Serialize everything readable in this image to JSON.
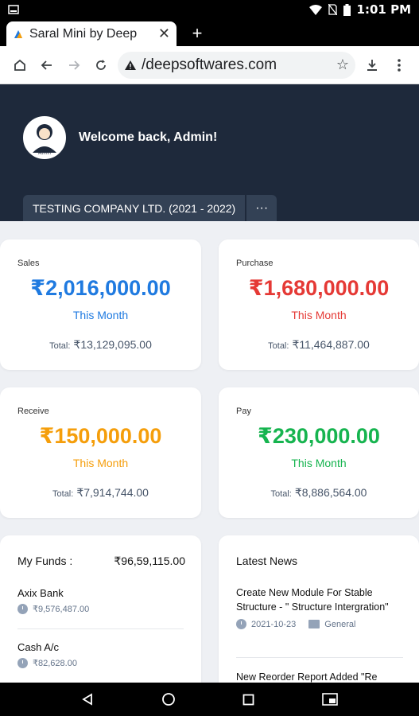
{
  "status_bar": {
    "time": "1:01 PM"
  },
  "browser": {
    "tab_title": "Saral Mini by Deep",
    "url": "deepsoftwares.com",
    "url_prefix": "/"
  },
  "header": {
    "welcome": "Welcome back, Admin!",
    "avatar_label": "Admin",
    "company": "TESTING COMPANY LTD. (2021 - 2022)",
    "more": "···"
  },
  "cards": [
    {
      "label": "Sales",
      "amount": "₹2,016,000.00",
      "period": "This Month",
      "total_label": "Total:",
      "total": "₹13,129,095.00",
      "color": "#1f7ae0"
    },
    {
      "label": "Purchase",
      "amount": "₹1,680,000.00",
      "period": "This Month",
      "total_label": "Total:",
      "total": "₹11,464,887.00",
      "color": "#e53935"
    },
    {
      "label": "Receive",
      "amount": "₹150,000.00",
      "period": "This Month",
      "total_label": "Total:",
      "total": "₹7,914,744.00",
      "color": "#f59e0b"
    },
    {
      "label": "Pay",
      "amount": "₹230,000.00",
      "period": "This Month",
      "total_label": "Total:",
      "total": "₹8,886,564.00",
      "color": "#16b44f"
    }
  ],
  "funds": {
    "title": "My Funds :",
    "total": "₹96,59,115.00",
    "items": [
      {
        "name": "Axix Bank",
        "balance": "₹9,576,487.00"
      },
      {
        "name": "Cash A/c",
        "balance": "₹82,628.00"
      }
    ]
  },
  "news": {
    "title": "Latest News",
    "items": [
      {
        "title": "Create New Module For Stable Structure - \" Structure Intergration\"",
        "date": "2021-10-23",
        "category": "General"
      },
      {
        "title": "New Reorder Report Added \"Re",
        "date": "",
        "category": ""
      }
    ]
  }
}
